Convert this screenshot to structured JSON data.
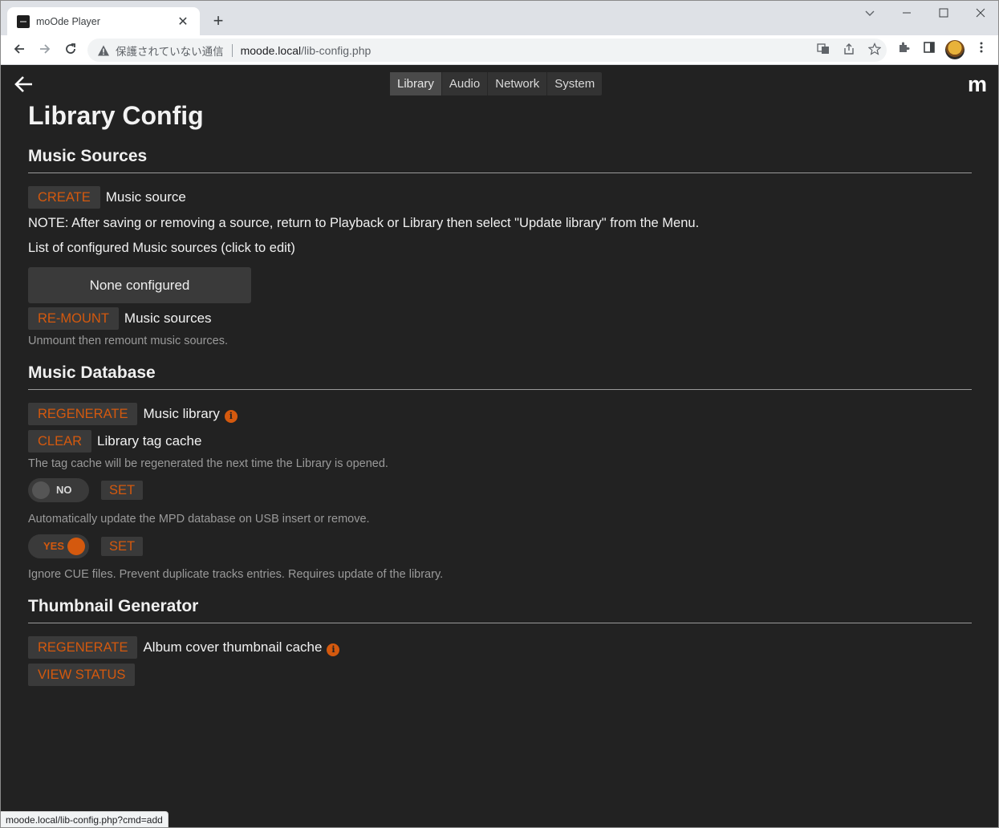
{
  "browser": {
    "tab_title": "moOde Player",
    "new_tab": "+",
    "close_tab": "✕",
    "security_text": "保護されていない通信",
    "url_host": "moode.local",
    "url_path": "/lib-config.php",
    "status_url": "moode.local/lib-config.php?cmd=add"
  },
  "nav": {
    "tabs": [
      {
        "label": "Library",
        "active": true
      },
      {
        "label": "Audio",
        "active": false
      },
      {
        "label": "Network",
        "active": false
      },
      {
        "label": "System",
        "active": false
      }
    ],
    "logo": "m"
  },
  "page": {
    "title": "Library Config",
    "music_sources": {
      "heading": "Music Sources",
      "create_button": "CREATE",
      "create_label": "Music source",
      "note": "NOTE: After saving or removing a source, return to Playback or Library then select \"Update library\" from the Menu.",
      "list_label": "List of configured Music sources (click to edit)",
      "none_configured": "None configured",
      "remount_button": "RE-MOUNT",
      "remount_label": "Music sources",
      "remount_help": "Unmount then remount music sources."
    },
    "music_database": {
      "heading": "Music Database",
      "regenerate_button": "REGENERATE",
      "regenerate_label": "Music library",
      "clear_button": "CLEAR",
      "clear_label": "Library tag cache",
      "clear_help": "The tag cache will be regenerated the next time the Library is opened.",
      "usb_toggle": {
        "state": "NO",
        "on": false
      },
      "usb_set": "SET",
      "usb_help": "Automatically update the MPD database on USB insert or remove.",
      "cue_toggle": {
        "state": "YES",
        "on": true
      },
      "cue_set": "SET",
      "cue_help": "Ignore CUE files. Prevent duplicate tracks entries. Requires update of the library."
    },
    "thumbnail": {
      "heading": "Thumbnail Generator",
      "regenerate_button": "REGENERATE",
      "regenerate_label": "Album cover thumbnail cache",
      "view_status_button": "VIEW STATUS"
    }
  },
  "colors": {
    "accent": "#d4590e",
    "background": "#222222",
    "button_bg": "#3a3a3a"
  }
}
